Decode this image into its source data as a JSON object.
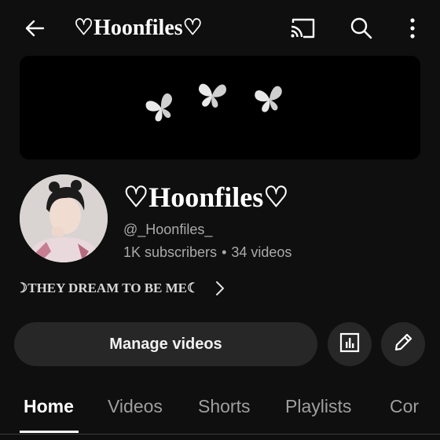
{
  "header": {
    "title": "♡Hoonfiles♡",
    "back_icon": "arrow-left-icon",
    "cast_icon": "cast-icon",
    "search_icon": "search-icon",
    "more_icon": "more-vertical-icon"
  },
  "banner": {
    "decoration": "three white butterflies on black"
  },
  "channel": {
    "name": "♡Hoonfiles♡",
    "handle": "@_Hoonfiles_",
    "subscribers": "1K subscribers",
    "separator": "•",
    "videos": "34 videos",
    "description": "☽THEY DREAM TO BE ME☾"
  },
  "actions": {
    "manage_label": "Manage videos",
    "analytics_icon": "analytics-icon",
    "edit_icon": "pencil-icon"
  },
  "tabs": [
    {
      "label": "Home",
      "active": true
    },
    {
      "label": "Videos",
      "active": false
    },
    {
      "label": "Shorts",
      "active": false
    },
    {
      "label": "Playlists",
      "active": false
    },
    {
      "label": "Cor",
      "active": false
    }
  ],
  "colors": {
    "background": "#0f0f0f",
    "button": "#272727",
    "text_primary": "#ffffff",
    "text_secondary": "#aaaaaa"
  }
}
